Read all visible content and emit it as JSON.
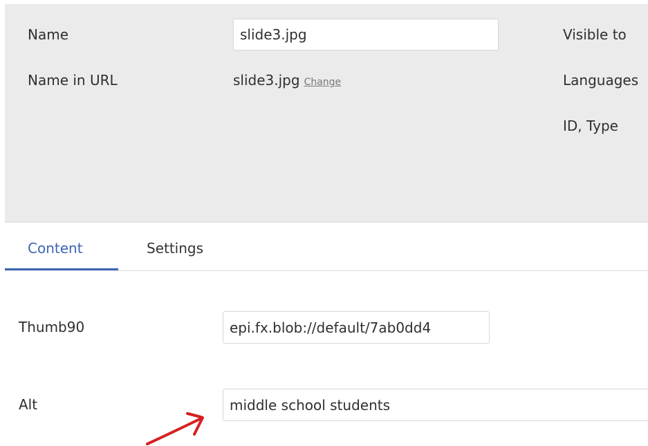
{
  "properties": {
    "name_label": "Name",
    "name_value": "slide3.jpg",
    "name_in_url_label": "Name in URL",
    "name_in_url_value": "slide3.jpg",
    "change_link": "Change",
    "visible_to_label": "Visible to",
    "languages_label": "Languages",
    "id_type_label": "ID, Type"
  },
  "tabs": [
    {
      "label": "Content",
      "active": true
    },
    {
      "label": "Settings",
      "active": false
    }
  ],
  "fields": {
    "thumb90_label": "Thumb90",
    "thumb90_value": "epi.fx.blob://default/7ab0dd4",
    "alt_label": "Alt",
    "alt_value": "middle school students"
  },
  "colors": {
    "panel_background": "#ebebeb",
    "active_tab": "#3b66b5",
    "annotation_arrow": "#d42020"
  },
  "annotation": {
    "icon": "red-arrow-icon"
  }
}
